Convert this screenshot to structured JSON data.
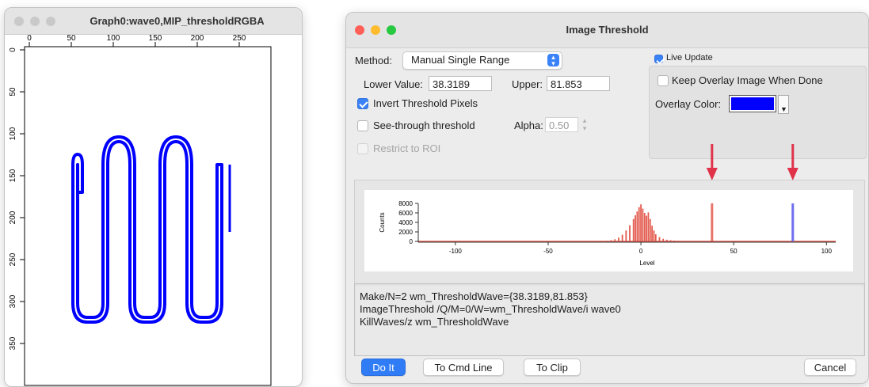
{
  "graph_window": {
    "title": "Graph0:wave0,MIP_thresholdRGBA",
    "x_ticks": [
      "0",
      "50",
      "100",
      "150",
      "200",
      "250"
    ],
    "y_ticks": [
      "0",
      "50",
      "100",
      "150",
      "200",
      "250",
      "300",
      "350"
    ],
    "trace_color": "#0000ff"
  },
  "dialog": {
    "title": "Image Threshold",
    "method_label": "Method:",
    "method_value": "Manual Single Range",
    "lower_label": "Lower Value:",
    "lower_value": "38.3189",
    "upper_label": "Upper:",
    "upper_value": "81.853",
    "invert_label": "Invert Threshold Pixels",
    "invert_checked": true,
    "see_through_label": "See-through threshold",
    "see_through_checked": false,
    "alpha_label": "Alpha:",
    "alpha_value": "0.50",
    "restrict_label": "Restrict to ROI",
    "live_update_label": "Live Update",
    "live_update_checked": true,
    "keep_overlay_label": "Keep Overlay Image When Done",
    "keep_overlay_checked": false,
    "overlay_color_label": "Overlay Color:",
    "overlay_color": "#0000ff",
    "command_lines": [
      "Make/N=2 wm_ThresholdWave={38.3189,81.853}",
      "ImageThreshold /Q/M=0/W=wm_ThresholdWave/i wave0",
      "KillWaves/z wm_ThresholdWave"
    ],
    "buttons": {
      "do_it": "Do It",
      "to_cmd_line": "To Cmd Line",
      "to_clip": "To Clip",
      "cancel": "Cancel"
    }
  },
  "chart_data": {
    "type": "bar",
    "xlabel": "Level",
    "ylabel": "Counts",
    "xlim": [
      -120,
      105
    ],
    "ylim": [
      0,
      8000
    ],
    "x_ticks": [
      "-100",
      "-50",
      "0",
      "50",
      "100"
    ],
    "y_ticks": [
      "0",
      "2000",
      "4000",
      "6000",
      "8000"
    ],
    "bar_color": "#e35b4f",
    "series": [
      {
        "x": [
          -18,
          -16,
          -14,
          -12,
          -10,
          -8,
          -6,
          -4,
          -3,
          -2,
          -1,
          0,
          1,
          2,
          3,
          4,
          5,
          6,
          7,
          8,
          10,
          12,
          14,
          16,
          18,
          20,
          22
        ],
        "values": [
          120,
          250,
          450,
          800,
          1400,
          2300,
          3400,
          4700,
          5500,
          6300,
          7200,
          7800,
          6900,
          6000,
          5400,
          6100,
          4700,
          3300,
          2300,
          1500,
          900,
          550,
          350,
          250,
          170,
          120,
          80
        ]
      }
    ],
    "lower_threshold": 38.3189,
    "upper_threshold": 81.853,
    "lower_threshold_color": "#e35b4f",
    "upper_threshold_color": "#6f6ff0",
    "arrow_color": "#e0334a"
  }
}
